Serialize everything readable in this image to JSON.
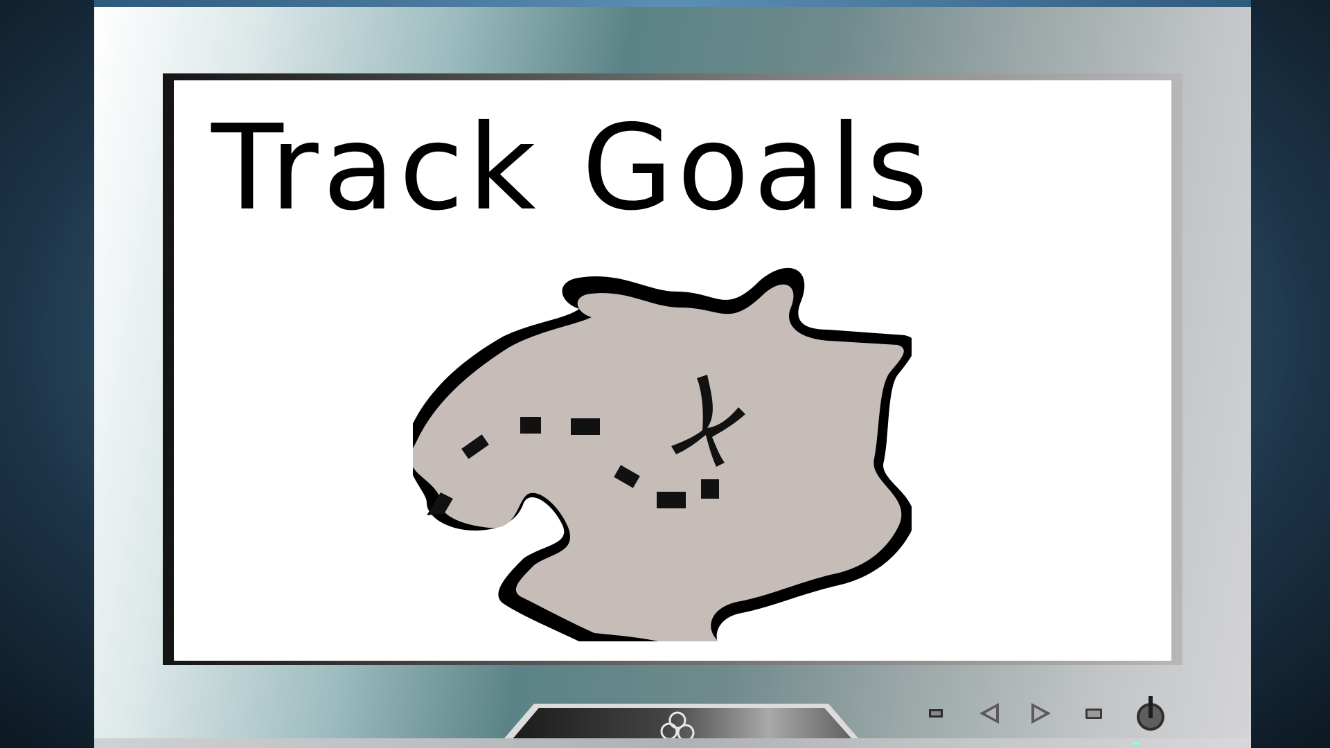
{
  "screen": {
    "title": "Track Goals",
    "illustration": "treasure-map"
  },
  "controls": {
    "icons": [
      "menu-icon",
      "previous-icon",
      "next-icon",
      "input-source-icon",
      "power-icon"
    ]
  },
  "colors": {
    "map_fill": "#c7bdb8",
    "outline": "#000000",
    "power_led": "#8fffd0"
  }
}
